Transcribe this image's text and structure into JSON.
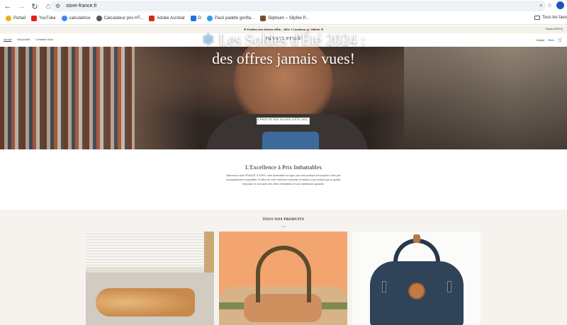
{
  "browser": {
    "url": "store-france.fr",
    "avatar_initial": "A",
    "bookmarks": [
      {
        "label": "Portail",
        "icon": "sunflower-icon",
        "color": "#e8b21b"
      },
      {
        "label": "YouTube",
        "icon": "youtube-icon",
        "color": "#e62117"
      },
      {
        "label": "calculatrice",
        "icon": "google-icon",
        "color": "#4285f4"
      },
      {
        "label": "Calculateur prix HT...",
        "icon": "globe-icon",
        "color": "#555555"
      },
      {
        "label": "Adobe Acrobat",
        "icon": "acrobat-icon",
        "color": "#d4281c"
      },
      {
        "label": "D",
        "icon": "doc-icon",
        "color": "#1a73e8"
      },
      {
        "label": "Pack paddle gonfla...",
        "icon": "paddle-icon",
        "color": "#26a1e0"
      },
      {
        "label": "Silphium – Silphie P...",
        "icon": "plant-icon",
        "color": "#7a4b2b"
      }
    ],
    "all_bookmarks_label": "Tous les favo"
  },
  "site": {
    "announcement": "☀ Profitez des Soldes d'Été : -50% + Livraison 🚚 Offerte ☀",
    "language": "France (EUR €)",
    "nav": [
      "Accueil",
      "Nos produit",
      "Contactez Nous"
    ],
    "brand": "FRANCE STORE",
    "account_label": "Compte",
    "search_label": "Rech",
    "hero": {
      "title_line1": "Les Soldes d'Été 2024 :",
      "title_line2": "des offres jamais vues!",
      "snow_icon": "❄",
      "button": "À PROFITE DES SOLDES D'ÉTÉ 2024 !"
    },
    "intro": {
      "title": "L'Excellence à Prix Imbattables",
      "text": "Bienvenue chez FRANCE STORE, votre destination en ligne pour des produits d'exception à des prix incroyablement compétitifs. Profitez de notre sélection exclusive et laissez-vous séduire par la qualité française, le tout avec des offres irrésistibles et une satisfaction garantie."
    },
    "products": {
      "title": "TOUS NOS PRODUITS",
      "subtitle": "Voir"
    }
  }
}
